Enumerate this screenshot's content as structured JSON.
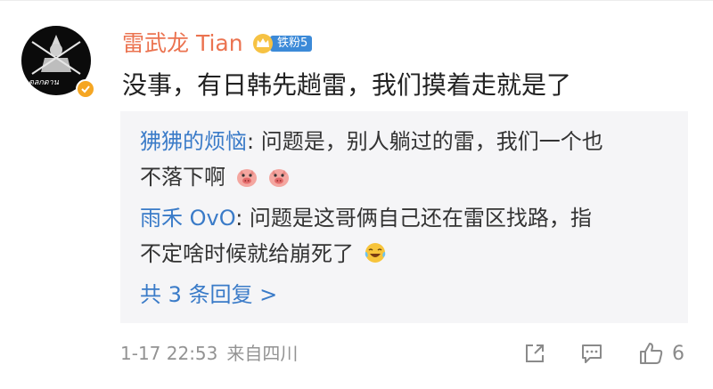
{
  "comment": {
    "author": "雷武龙 Tian",
    "fan_badge": "铁粉5",
    "text": "没事，有日韩先趟雷，我们摸着走就是了",
    "avatar_icon": "warrior-logo-icon",
    "avatar_text": "ตลกดาน",
    "verified_icon": "verified-badge-icon"
  },
  "replies": [
    {
      "author": "狒狒的烦恼",
      "separator": ": ",
      "line1": "问题是，别人躺过的雷，我们一个也",
      "line2": "不落下啊",
      "emojis": [
        "pig-face-emoji",
        "pig-face-emoji"
      ]
    },
    {
      "author": "雨禾 OvO",
      "separator": ": ",
      "line1": "问题是这哥俩自己还在雷区找路，指",
      "line2": "不定啥时候就给崩死了",
      "emojis": [
        "laughing-tears-emoji"
      ]
    }
  ],
  "more_replies": "共 3 条回复 >",
  "meta": {
    "timestamp": "1-17 22:53",
    "source": "来自四川"
  },
  "actions": {
    "share_icon": "share-icon",
    "comment_icon": "comment-icon",
    "like_icon": "thumbs-up-icon",
    "like_count": "6"
  },
  "colors": {
    "author": "#eb7350",
    "reply_author": "#3a7bc8",
    "reply_background": "#f5f5f7",
    "meta_text": "#939393",
    "fan_badge": "#3c8ad8"
  }
}
